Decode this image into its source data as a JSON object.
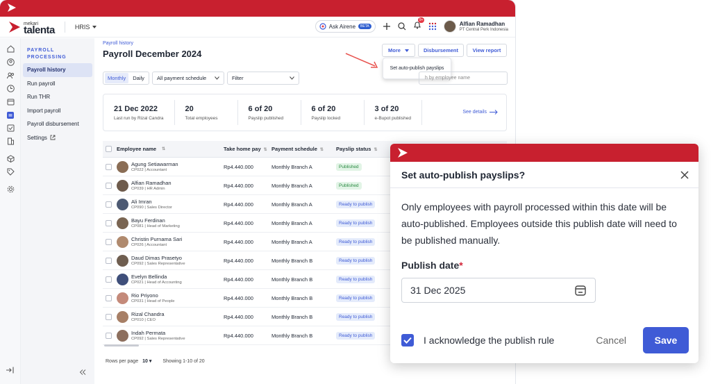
{
  "brand": {
    "small": "mekari",
    "big": "talenta"
  },
  "header": {
    "module": "HRIS",
    "ask_label": "Ask Airene",
    "beta": "BETA",
    "notif_count": "9+",
    "user_name": "Alfian Ramadhan",
    "user_company": "PT Central Perk Indonesia"
  },
  "sidebar": {
    "title_line1": "PAYROLL",
    "title_line2": "PROCESSING",
    "items": [
      "Payroll history",
      "Run payroll",
      "Run THR",
      "Import payroll",
      "Payroll disbursement",
      "Settings"
    ]
  },
  "page": {
    "breadcrumb": "Payroll history",
    "title": "Payroll December 2024",
    "more": "More",
    "disbursement": "Disbursement",
    "view_report": "View report",
    "dropdown_item": "Set auto-publish payslips"
  },
  "filters": {
    "monthly": "Monthly",
    "daily": "Daily",
    "schedule": "All payment schedule",
    "filter": "Filter",
    "search_placeholder": "h by employee name"
  },
  "stats": [
    {
      "value": "21 Dec 2022",
      "label": "Last run by Rizal Candra"
    },
    {
      "value": "20",
      "label": "Total employees"
    },
    {
      "value": "6 of 20",
      "label": "Payslip published"
    },
    {
      "value": "6 of 20",
      "label": "Payslip locked"
    },
    {
      "value": "3 of 20",
      "label": "e-Bupot published"
    }
  ],
  "see_details": "See details",
  "table": {
    "columns": [
      "Employee name",
      "Take home pay",
      "Payment schedule",
      "Payslip status"
    ],
    "rows": [
      {
        "name": "Agung Setiawarman",
        "sub": "CP022 | Accountant",
        "pay": "Rp4.440.000",
        "schedule": "Monthly Branch A",
        "status": "Published"
      },
      {
        "name": "Alfian Ramadhan",
        "sub": "CP039 | HR Admin",
        "pay": "Rp4.440.000",
        "schedule": "Monthly Branch A",
        "status": "Published"
      },
      {
        "name": "Ali Imran",
        "sub": "CP090 | Sales Director",
        "pay": "Rp4.440.000",
        "schedule": "Monthly Branch A",
        "status": "Ready to publish"
      },
      {
        "name": "Bayu Ferdinan",
        "sub": "CP081 | Head of Marketing",
        "pay": "Rp4.440.000",
        "schedule": "Monthly Branch A",
        "status": "Ready to publish"
      },
      {
        "name": "Christin Purnama Sari",
        "sub": "CP026 | Accountant",
        "pay": "Rp4.440.000",
        "schedule": "Monthly Branch A",
        "status": "Ready to publish"
      },
      {
        "name": "Daud Dimas Prasetyo",
        "sub": "CP092 | Sales Representative",
        "pay": "Rp4.440.000",
        "schedule": "Monthly Branch B",
        "status": "Ready to publish"
      },
      {
        "name": "Evelyn Bellinda",
        "sub": "CP021 | Head of Accounting",
        "pay": "Rp4.440.000",
        "schedule": "Monthly Branch B",
        "status": "Ready to publish"
      },
      {
        "name": "Rio Priyono",
        "sub": "CP031 | Head of People",
        "pay": "Rp4.440.000",
        "schedule": "Monthly Branch B",
        "status": "Ready to publish"
      },
      {
        "name": "Rizal Chandra",
        "sub": "CP010 | CEO",
        "pay": "Rp4.440.000",
        "schedule": "Monthly Branch B",
        "status": "Ready to publish"
      },
      {
        "name": "Indah Permata",
        "sub": "CP092 | Sales Representative",
        "pay": "Rp4.440.000",
        "schedule": "Monthly Branch B",
        "status": "Ready to publish"
      }
    ]
  },
  "footer": {
    "rows_label": "Rows per page",
    "rows_value": "10",
    "showing": "Showing 1-10 of 20"
  },
  "modal": {
    "title": "Set auto-publish payslips?",
    "body": "Only employees with payroll processed within this date will be auto-published. Employees outside this publish date will need to be published manually.",
    "date_label": "Publish date",
    "required": "*",
    "date_value": "31 Dec 2025",
    "ack": "I acknowledge the publish rule",
    "cancel": "Cancel",
    "save": "Save"
  },
  "colors": {
    "brand_red": "#c8202f",
    "primary": "#3f5bd6"
  }
}
